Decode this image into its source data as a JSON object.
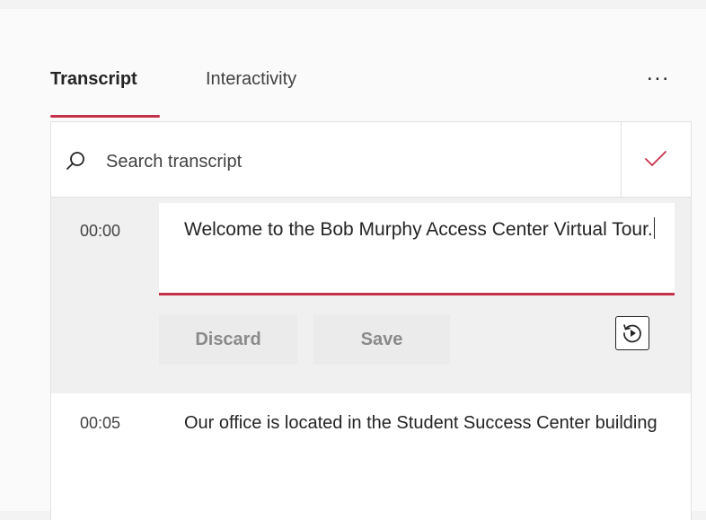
{
  "tabs": {
    "transcript": "Transcript",
    "interactivity": "Interactivity",
    "more": "..."
  },
  "search": {
    "placeholder": "Search transcript",
    "value": ""
  },
  "entries": [
    {
      "timestamp": "00:00",
      "text": "Welcome to the Bob Murphy Access Center Virtual Tour.",
      "editing": true
    },
    {
      "timestamp": "00:05",
      "text": "Our office is located in the Student Success Center building",
      "editing": false
    }
  ],
  "actions": {
    "discard": "Discard",
    "save": "Save"
  },
  "icons": {
    "search": "search-icon",
    "confirm": "checkmark-icon",
    "replay": "replay-icon",
    "more": "more-options-icon"
  },
  "colors": {
    "accent": "#c4314b",
    "text": "#242424",
    "muted": "#424242",
    "disabled_text": "#8a8a8a",
    "panel_bg": "#fafafa",
    "card_bg": "#ffffff",
    "edit_row_bg": "#f0f0f0"
  }
}
